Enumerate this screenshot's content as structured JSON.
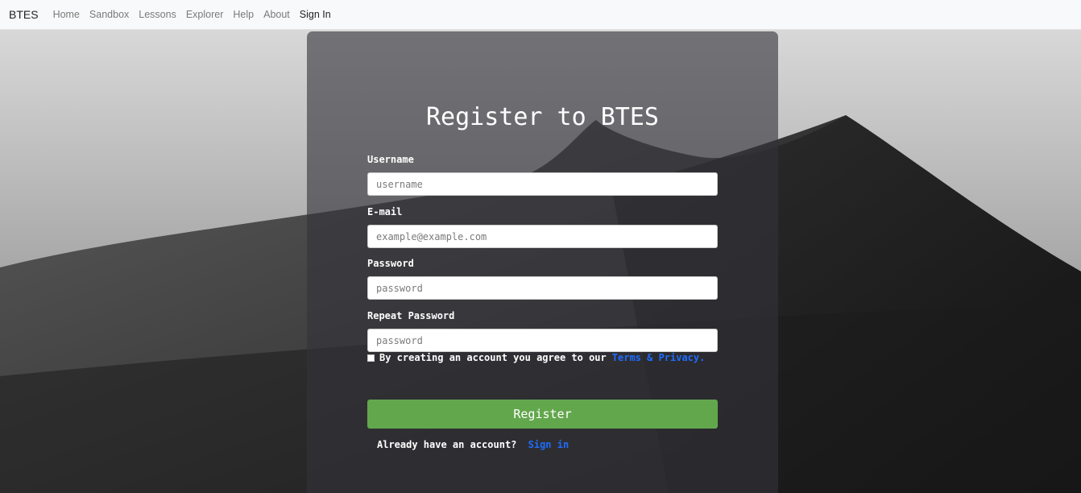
{
  "navbar": {
    "brand": "BTES",
    "links": [
      "Home",
      "Sandbox",
      "Lessons",
      "Explorer",
      "Help",
      "About",
      "Sign In"
    ]
  },
  "form": {
    "title": "Register to BTES",
    "username_label": "Username",
    "username_placeholder": "username",
    "email_label": "E-mail",
    "email_placeholder": "example@example.com",
    "password_label": "Password",
    "password_placeholder": "password",
    "repeat_label": "Repeat Password",
    "repeat_placeholder": "password",
    "agree_text": "By creating an account you agree to our",
    "terms_link": "Terms & Privacy.",
    "register_label": "Register",
    "already_text": "Already have an account?",
    "signin_link": "Sign in"
  },
  "colors": {
    "navbar_bg": "#f8f9fa",
    "register_bg": "#63a74d",
    "link": "#1e6cff"
  }
}
